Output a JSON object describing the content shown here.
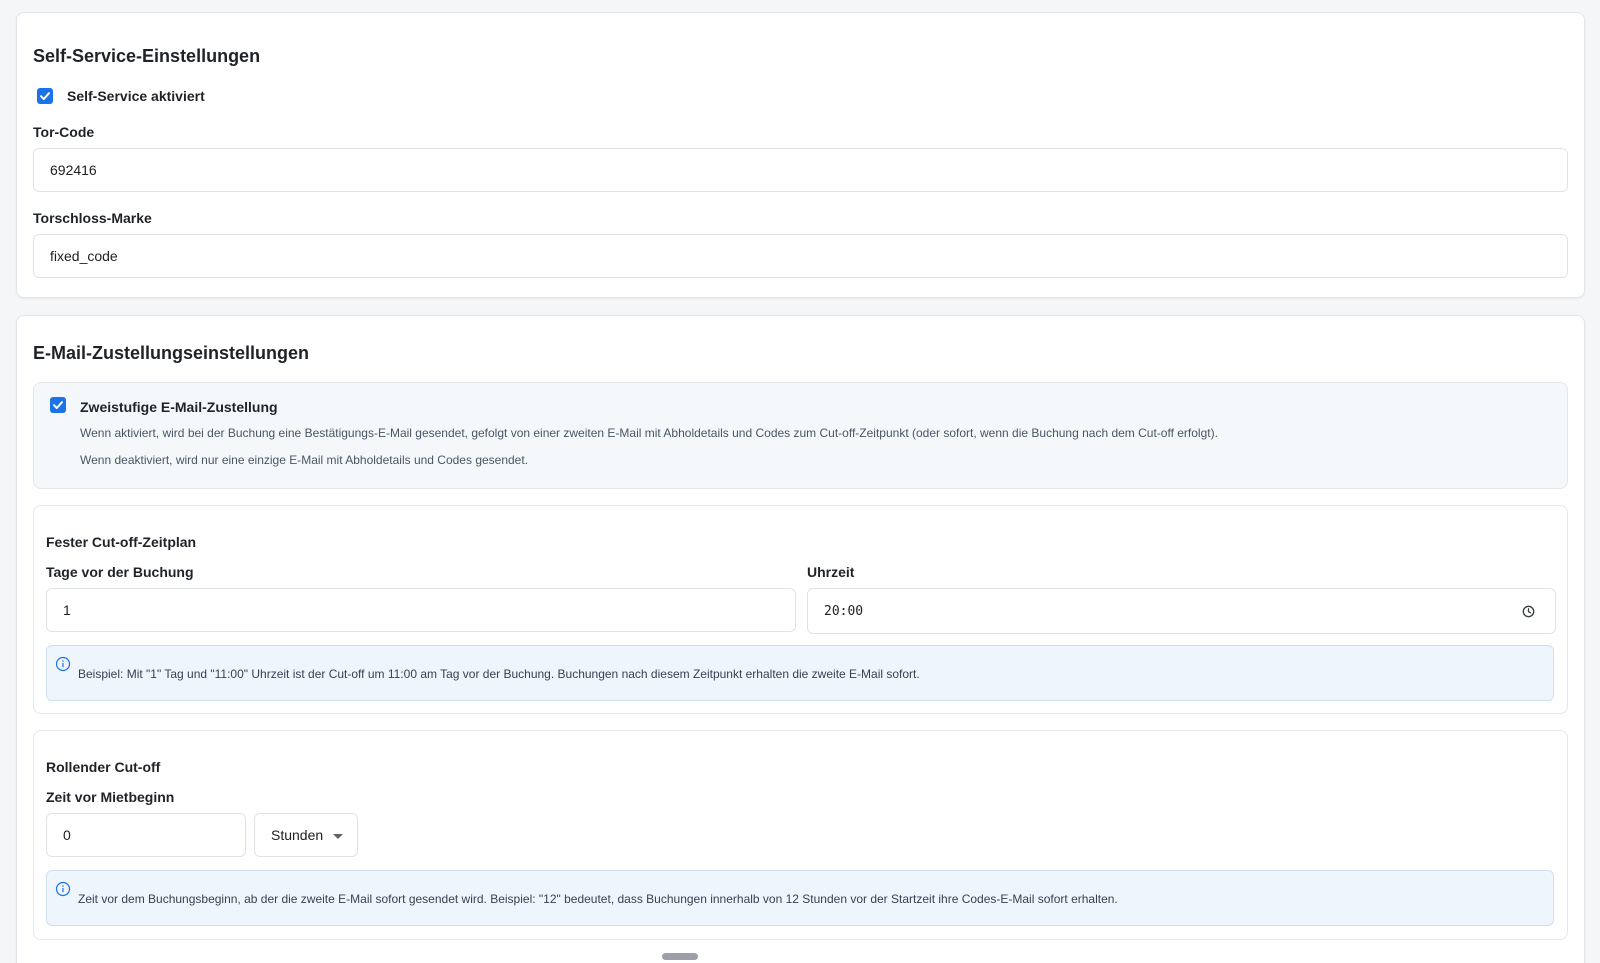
{
  "self_service": {
    "title": "Self-Service-Einstellungen",
    "enabled_label": "Self-Service aktiviert",
    "enabled": true,
    "gate_code_label": "Tor-Code",
    "gate_code_value": "692416",
    "lock_brand_label": "Torschloss-Marke",
    "lock_brand_value": "fixed_code"
  },
  "email_delivery": {
    "title": "E-Mail-Zustellungseinstellungen",
    "two_step": {
      "label": "Zweistufige E-Mail-Zustellung",
      "enabled": true,
      "desc_enabled": "Wenn aktiviert, wird bei der Buchung eine Bestätigungs-E-Mail gesendet, gefolgt von einer zweiten E-Mail mit Abholdetails und Codes zum Cut-off-Zeitpunkt (oder sofort, wenn die Buchung nach dem Cut-off erfolgt).",
      "desc_disabled": "Wenn deaktiviert, wird nur eine einzige E-Mail mit Abholdetails und Codes gesendet."
    },
    "fixed_cutoff": {
      "title": "Fester Cut-off-Zeitplan",
      "days_label": "Tage vor der Buchung",
      "days_value": "1",
      "time_label": "Uhrzeit",
      "time_value": "20:00",
      "info": "Beispiel: Mit \"1\" Tag und \"11:00\" Uhrzeit ist der Cut-off um 11:00 am Tag vor der Buchung. Buchungen nach diesem Zeitpunkt erhalten die zweite E-Mail sofort."
    },
    "rolling_cutoff": {
      "title": "Rollender Cut-off",
      "time_label": "Zeit vor Mietbeginn",
      "amount_value": "0",
      "unit_value": "Stunden",
      "info": "Zeit vor dem Buchungsbeginn, ab der die zweite E-Mail sofort gesendet wird. Beispiel: \"12\" bedeutet, dass Buchungen innerhalb von 12 Stunden vor der Startzeit ihre Codes-E-Mail sofort erhalten."
    }
  },
  "colors": {
    "accent": "#1a73e8",
    "info_bg": "#eff5fc",
    "info_border": "#cfdff0",
    "info_icon": "#1a73e8"
  }
}
